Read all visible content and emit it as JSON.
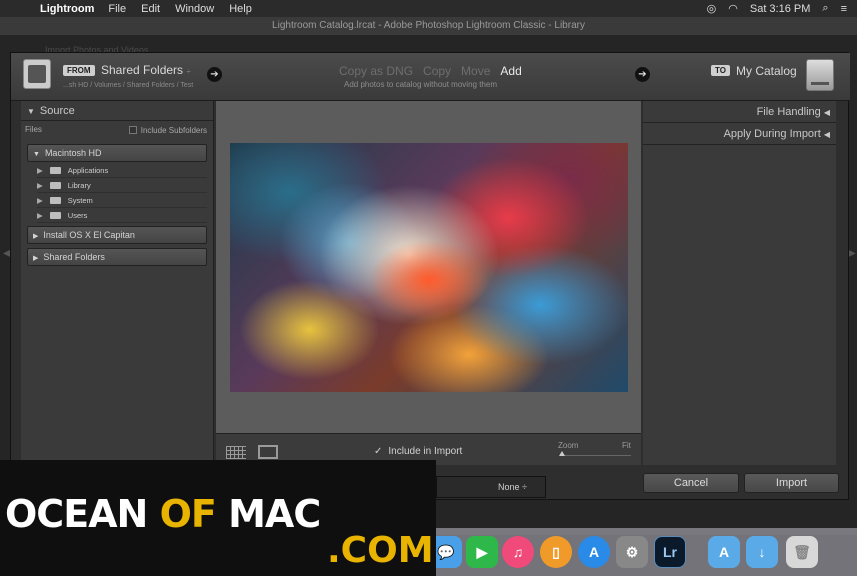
{
  "menubar": {
    "app": "Lightroom",
    "items": [
      "File",
      "Edit",
      "Window",
      "Help"
    ],
    "clock": "Sat 3:16 PM"
  },
  "window": {
    "title": "Lightroom Catalog.lrcat - Adobe Photoshop Lightroom Classic - Library"
  },
  "background": {
    "ghost_text": "Import Photos and Videos"
  },
  "topbar": {
    "from_badge": "FROM",
    "source_name": "Shared Folders",
    "source_arrow": "÷",
    "source_path": "...sh HD / Volumes / Shared Folders / Test",
    "modes": [
      "Copy as DNG",
      "Copy",
      "Move",
      "Add"
    ],
    "active_mode": "Add",
    "mode_description": "Add photos to catalog without moving them",
    "to_badge": "TO",
    "dest_name": "My Catalog"
  },
  "source_panel": {
    "header": "Source",
    "files_label": "Files",
    "include_subfolders": "Include Subfolders",
    "volumes": [
      {
        "name": "Macintosh HD",
        "expanded": true,
        "folders": [
          "Applications",
          "Library",
          "System",
          "Users"
        ]
      },
      {
        "name": "Install OS X El Capitan",
        "expanded": false,
        "folders": []
      },
      {
        "name": "Shared Folders",
        "expanded": false,
        "folders": []
      }
    ]
  },
  "preview_toolbar": {
    "include_label": "Include in Import",
    "zoom_label": "Zoom",
    "fit_label": "Fit"
  },
  "right_panel": {
    "sections": [
      "File Handling",
      "Apply During Import"
    ]
  },
  "metadata_select": {
    "value": "None"
  },
  "buttons": {
    "cancel": "Cancel",
    "import": "Import"
  },
  "watermark": {
    "part1": "OCEAN",
    "part2": "OF",
    "part3": "MAC",
    "part4": ".COM"
  }
}
